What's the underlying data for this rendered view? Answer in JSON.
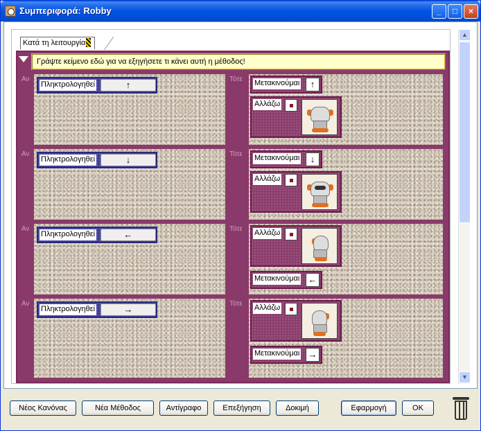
{
  "window": {
    "title": "Συμπεριφορά: Robby"
  },
  "tab": {
    "label": "Κατά τη λειτουργία"
  },
  "description": "Γράψτε κείμενο εδώ για να εξηγήσετε τι κάνει αυτή η μέθοδος!",
  "labels": {
    "if": "Αν",
    "then": "Τότε"
  },
  "rules": [
    {
      "condition": {
        "label": "Πληκτρολογηθεί",
        "key": "↑"
      },
      "actions": [
        {
          "type": "move",
          "label": "Μετακινούμαι",
          "arrow": "↑"
        },
        {
          "type": "change",
          "label": "Αλλάζω",
          "image": "robot-up-icon"
        }
      ]
    },
    {
      "condition": {
        "label": "Πληκτρολογηθεί",
        "key": "↓"
      },
      "actions": [
        {
          "type": "move",
          "label": "Μετακινούμαι",
          "arrow": "↓"
        },
        {
          "type": "change",
          "label": "Αλλάζω",
          "image": "robot-down-icon"
        }
      ]
    },
    {
      "condition": {
        "label": "Πληκτρολογηθεί",
        "key": "←"
      },
      "actions": [
        {
          "type": "change",
          "label": "Αλλάζω",
          "image": "robot-left-icon"
        },
        {
          "type": "move",
          "label": "Μετακινούμαι",
          "arrow": "←"
        }
      ]
    },
    {
      "condition": {
        "label": "Πληκτρολογηθεί",
        "key": "→"
      },
      "actions": [
        {
          "type": "change",
          "label": "Αλλάζω",
          "image": "robot-right-icon"
        },
        {
          "type": "move",
          "label": "Μετακινούμαι",
          "arrow": "→"
        }
      ]
    }
  ],
  "buttons": {
    "new_rule": "Νέος Κανόνας",
    "new_method": "Νέα Μέθοδος",
    "copy": "Αντίγραφο",
    "explain": "Επεξήγηση",
    "test": "Δοκιμή",
    "apply": "Εφαρμογή",
    "ok": "OK"
  }
}
